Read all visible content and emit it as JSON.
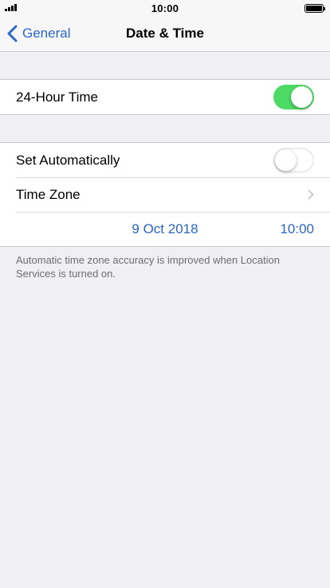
{
  "status_bar": {
    "time": "10:00",
    "signal_icon": "signal-strength-icon",
    "battery_icon": "battery-full-icon",
    "battery_level": 1.0
  },
  "nav": {
    "back_label": "General",
    "back_icon": "chevron-left-icon",
    "title": "Date & Time"
  },
  "settings": {
    "hour24": {
      "label": "24-Hour Time",
      "enabled": true
    },
    "set_automatically": {
      "label": "Set Automatically",
      "enabled": false
    },
    "time_zone": {
      "label": "Time Zone",
      "icon": "chevron-right-icon"
    },
    "date": "9 Oct 2018",
    "time": "10:00"
  },
  "footer_note": "Automatic time zone accuracy is improved when Location Services is turned on.",
  "colors": {
    "accent": "#2a66c8",
    "toggle_on": "#4cd964",
    "background": "#efeff4",
    "footer_text": "#6d6d72"
  }
}
